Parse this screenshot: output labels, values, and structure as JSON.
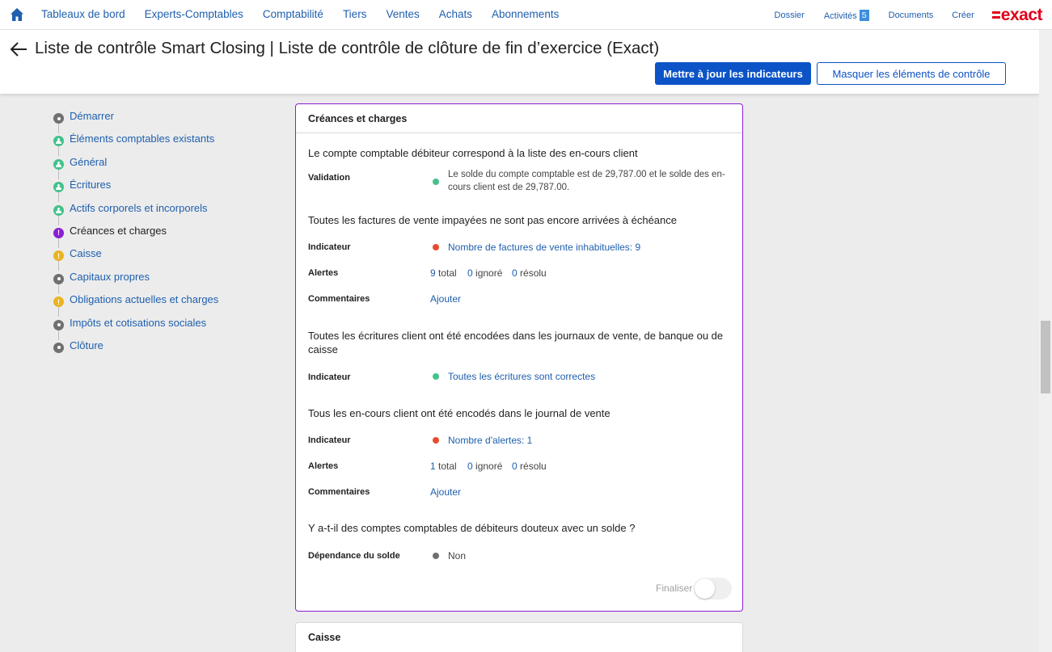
{
  "nav": {
    "links": [
      "Tableaux de bord",
      "Experts-Comptables",
      "Comptabilité",
      "Tiers",
      "Ventes",
      "Achats",
      "Abonnements"
    ],
    "right": {
      "dossier": "Dossier",
      "activites": "Activités",
      "activites_count": "5",
      "documents": "Documents",
      "creer": "Créer"
    },
    "logo": "exact"
  },
  "header": {
    "title": "Liste de contrôle Smart Closing | Liste de contrôle de clôture de fin d’exercice (Exact)",
    "update_button": "Mettre à jour les indicateurs",
    "hide_button": "Masquer les éléments de contrôle"
  },
  "steps": [
    {
      "label": "Démarrer",
      "status": "grey"
    },
    {
      "label": "Éléments comptables existants",
      "status": "green"
    },
    {
      "label": "Général",
      "status": "green"
    },
    {
      "label": "Écritures",
      "status": "green"
    },
    {
      "label": "Actifs corporels et incorporels",
      "status": "green"
    },
    {
      "label": "Créances et charges",
      "status": "purple"
    },
    {
      "label": "Caisse",
      "status": "yellow"
    },
    {
      "label": "Capitaux propres",
      "status": "grey"
    },
    {
      "label": "Obligations actuelles et charges",
      "status": "yellow"
    },
    {
      "label": "Impôts et cotisations sociales",
      "status": "grey"
    },
    {
      "label": "Clôture",
      "status": "grey"
    }
  ],
  "card": {
    "title": "Créances et charges",
    "q1": {
      "title": "Le compte comptable débiteur correspond à la liste des en-cours client",
      "label": "Validation",
      "text": "Le solde du compte comptable est de 29,787.00 et le solde des en-cours client est de 29,787.00."
    },
    "q2": {
      "title": "Toutes les factures de vente impayées ne sont pas encore arrivées à échéance",
      "indicator_label": "Indicateur",
      "indicator_value": "Nombre de factures de vente inhabituelles: 9",
      "alerts_label": "Alertes",
      "total_n": "9",
      "total_t": "total",
      "ignored_n": "0",
      "ignored_t": "ignoré",
      "resolved_n": "0",
      "resolved_t": "résolu",
      "comments_label": "Commentaires",
      "comments_link": "Ajouter"
    },
    "q3": {
      "title": "Toutes les écritures client ont été encodées dans les journaux de vente, de banque ou de caisse",
      "indicator_label": "Indicateur",
      "indicator_value": "Toutes les écritures sont correctes"
    },
    "q4": {
      "title": "Tous les en-cours client ont été encodés dans le journal de vente",
      "indicator_label": "Indicateur",
      "indicator_value": "Nombre d'alertes: 1",
      "alerts_label": "Alertes",
      "total_n": "1",
      "total_t": "total",
      "ignored_n": "0",
      "ignored_t": "ignoré",
      "resolved_n": "0",
      "resolved_t": "résolu",
      "comments_label": "Commentaires",
      "comments_link": "Ajouter"
    },
    "q5": {
      "title": "Y a-t-il des comptes comptables de débiteurs douteux avec un solde ?",
      "label": "Dépendance du solde",
      "value": "Non"
    },
    "finaliser": "Finaliser"
  },
  "next_card": {
    "title": "Caisse"
  },
  "colors": {
    "link": "#1f5fad",
    "primary": "#0b53c7",
    "active_border": "#8a1fd3",
    "green": "#43c28b",
    "red": "#e74c2e",
    "yellow": "#e8b422",
    "grey": "#707070",
    "brand": "#e1001a"
  }
}
